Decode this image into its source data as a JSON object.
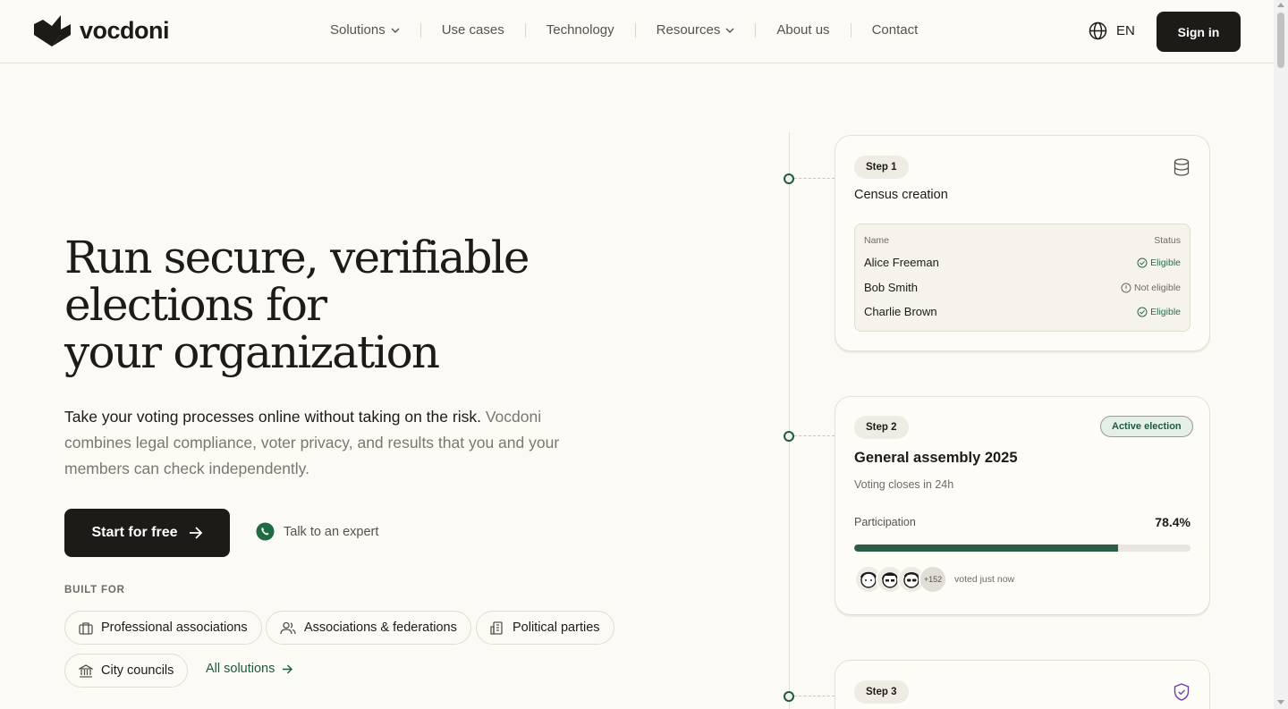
{
  "header": {
    "logo_text": "vocdoni",
    "nav": [
      {
        "label": "Solutions",
        "dropdown": true
      },
      {
        "label": "Use cases",
        "dropdown": false
      },
      {
        "label": "Technology",
        "dropdown": false
      },
      {
        "label": "Resources",
        "dropdown": true
      },
      {
        "label": "About us",
        "dropdown": false
      },
      {
        "label": "Contact",
        "dropdown": false
      }
    ],
    "lang": "EN",
    "sign_in": "Sign in"
  },
  "hero": {
    "headline": [
      "Run secure, verifiable",
      "elections for",
      "your organization"
    ],
    "lead_strong": "Take your voting processes online without taking on the risk.",
    "lead_rest": " Vocdoni combines legal compliance, voter privacy, and results that you and your members can check independently.",
    "cta_primary": "Start for free",
    "cta_secondary": "Talk to an expert",
    "built_for_label": "BUILT FOR",
    "chips": [
      {
        "label": "Professional associations",
        "icon": "briefcase-icon"
      },
      {
        "label": "Associations & federations",
        "icon": "users-icon"
      },
      {
        "label": "Political parties",
        "icon": "building-icon"
      },
      {
        "label": "City councils",
        "icon": "landmark-icon"
      }
    ],
    "all_solutions": "All solutions"
  },
  "steps": {
    "step1": {
      "pill": "Step 1",
      "title": "Census creation",
      "table_headers": {
        "name": "Name",
        "status": "Status"
      },
      "rows": [
        {
          "name": "Alice Freeman",
          "status": "Eligible",
          "ok": true
        },
        {
          "name": "Bob Smith",
          "status": "Not eligible",
          "ok": false
        },
        {
          "name": "Charlie Brown",
          "status": "Eligible",
          "ok": true
        }
      ]
    },
    "step2": {
      "pill": "Step 2",
      "badge": "Active election",
      "title": "General assembly 2025",
      "closes": "Voting closes in 24h",
      "participation_label": "Participation",
      "participation_value": "78.4%",
      "participation_fraction": 0.784,
      "extra_voters": "+152",
      "voted_text": "voted just now"
    },
    "step3": {
      "pill": "Step 3"
    }
  },
  "colors": {
    "background": "#fcfaf4",
    "ink": "#1c1b17",
    "accent_green": "#1f5b3f",
    "muted": "#7a776e"
  }
}
